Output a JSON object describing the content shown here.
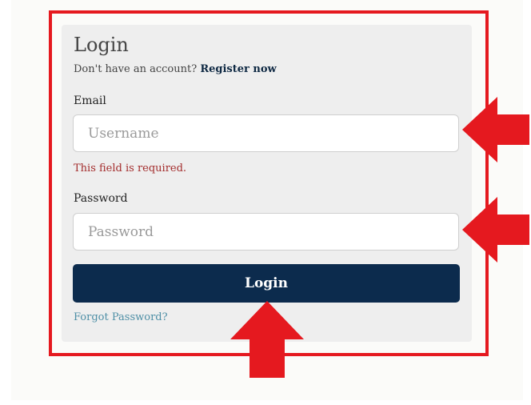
{
  "login": {
    "title": "Login",
    "register_prompt": "Don't have an account?",
    "register_link": "Register now",
    "email_label": "Email",
    "email_placeholder": "Username",
    "email_value": "",
    "email_error": "This field is required.",
    "password_label": "Password",
    "password_placeholder": "Password",
    "password_value": "",
    "submit_label": "Login",
    "forgot_link": "Forgot Password?"
  },
  "annotations": {
    "highlight_color": "#e5191f",
    "arrows": [
      {
        "target": "email-field",
        "direction": "left"
      },
      {
        "target": "password-field",
        "direction": "left"
      },
      {
        "target": "login-button",
        "direction": "up"
      }
    ]
  },
  "colors": {
    "button": "#0c2b4d",
    "error": "#a32c2c",
    "link": "#4e8fa6",
    "card": "#eeeeee"
  }
}
